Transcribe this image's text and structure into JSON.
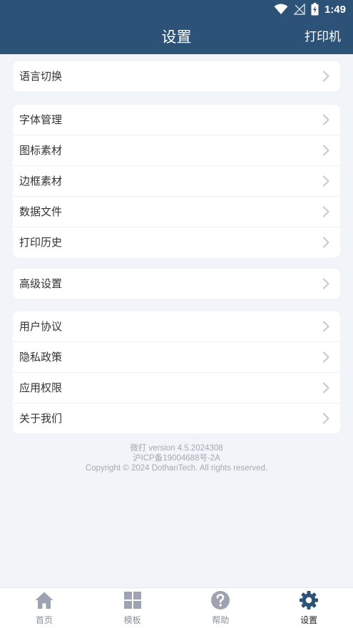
{
  "status": {
    "time": "1:49"
  },
  "header": {
    "title": "设置",
    "action": "打印机"
  },
  "groups": [
    {
      "items": [
        {
          "label": "语言切换"
        }
      ]
    },
    {
      "items": [
        {
          "label": "字体管理"
        },
        {
          "label": "图标素材"
        },
        {
          "label": "边框素材"
        },
        {
          "label": "数据文件"
        },
        {
          "label": "打印历史"
        }
      ]
    },
    {
      "items": [
        {
          "label": "高级设置"
        }
      ]
    },
    {
      "items": [
        {
          "label": "用户协议"
        },
        {
          "label": "隐私政策"
        },
        {
          "label": "应用权限"
        },
        {
          "label": "关于我们"
        }
      ]
    }
  ],
  "footer": {
    "version": "微打 version 4.5.2024308",
    "icp": "沪ICP备19004688号-2A",
    "copyright": "Copyright © 2024 DothanTech. All rights reserved."
  },
  "tabs": [
    {
      "label": "首页",
      "icon": "home-icon"
    },
    {
      "label": "模板",
      "icon": "grid-icon"
    },
    {
      "label": "帮助",
      "icon": "help-icon"
    },
    {
      "label": "设置",
      "icon": "gear-icon",
      "active": true
    }
  ],
  "colors": {
    "primary": "#2c5377",
    "background": "#f1f4f8",
    "tab_icon": "#9ea3b1",
    "tab_active_icon": "#2c5377"
  }
}
